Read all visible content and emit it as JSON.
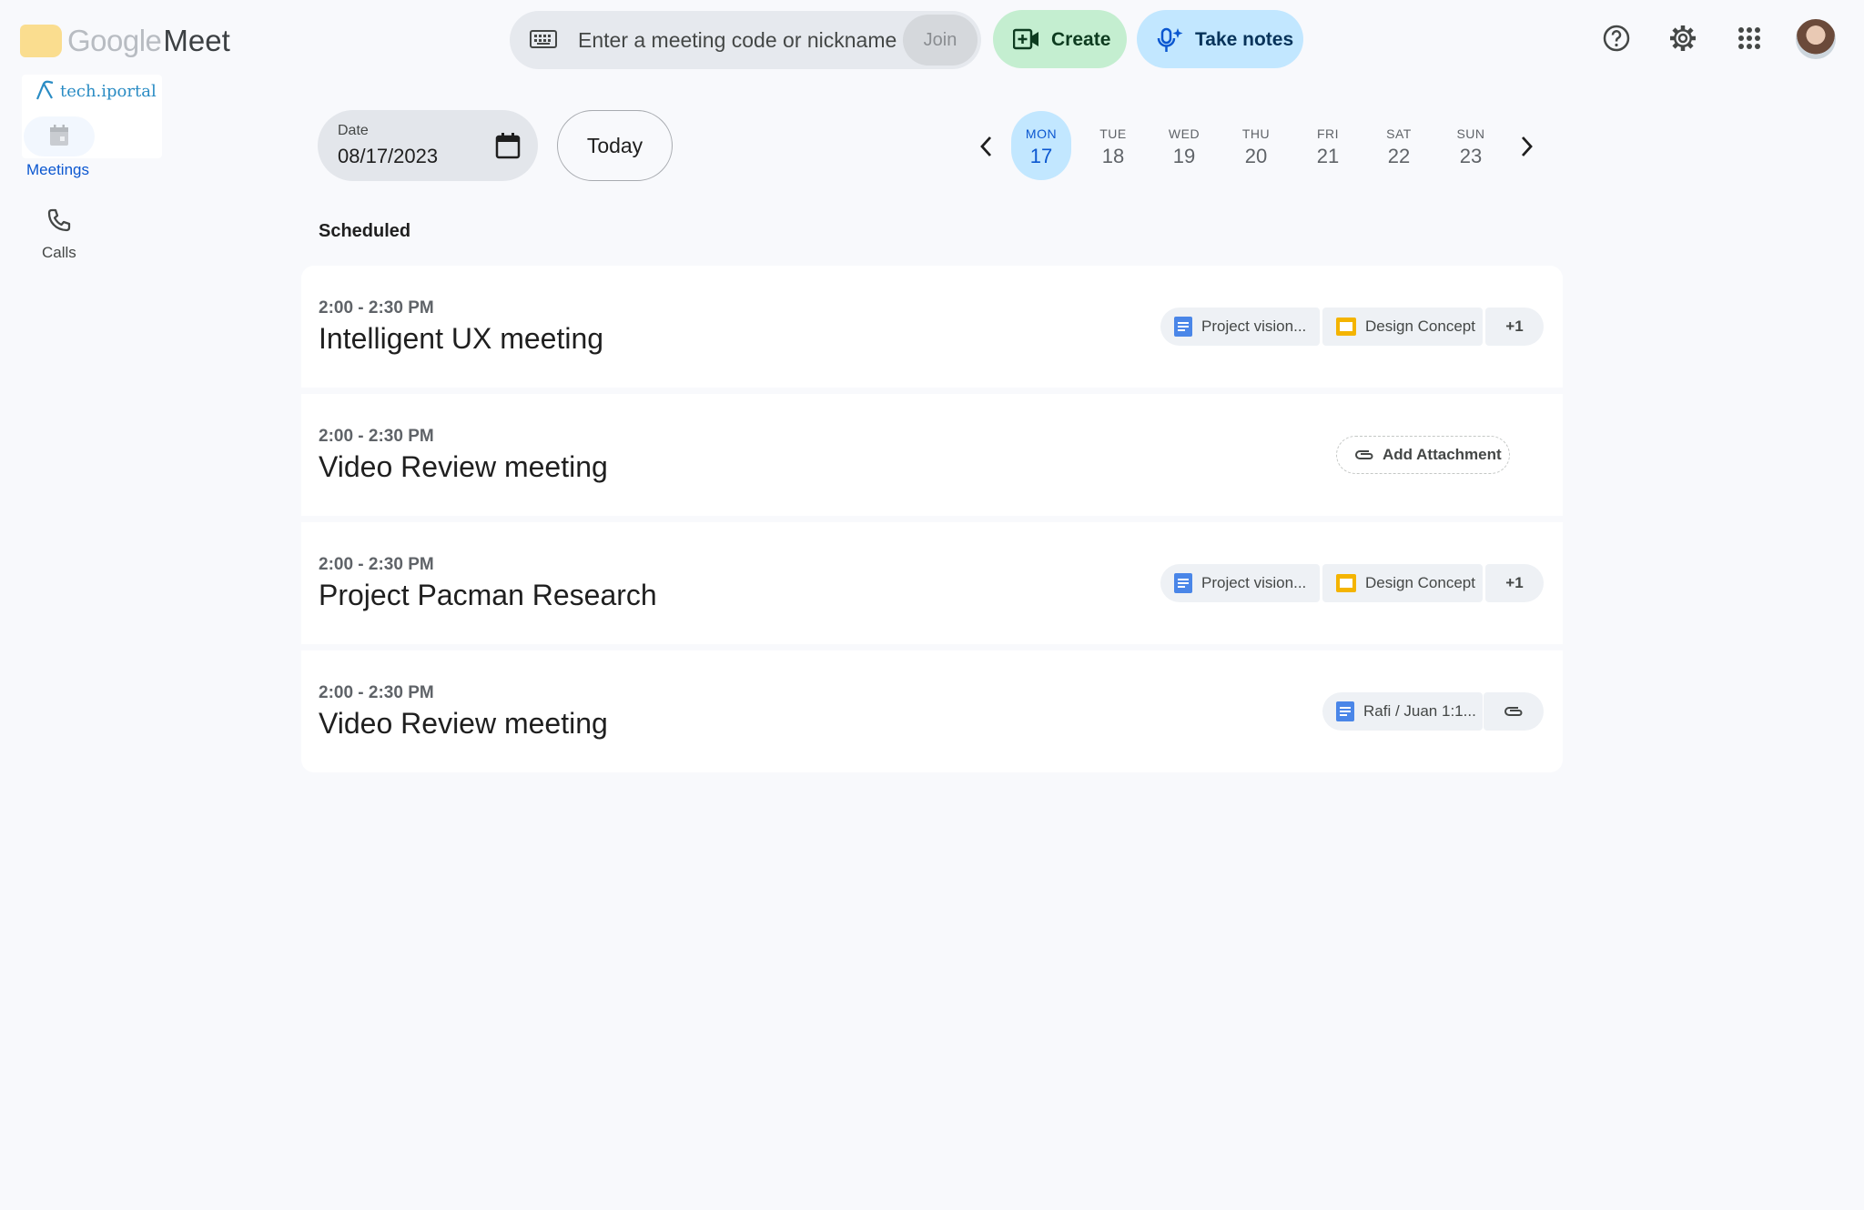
{
  "header": {
    "logo_google": "Google",
    "logo_meet": "Meet",
    "search_placeholder": "Enter a meeting code or nickname",
    "join_label": "Join",
    "create_label": "Create",
    "notes_label": "Take notes"
  },
  "badge": {
    "text": "tech.iportal"
  },
  "sidebar": {
    "items": [
      {
        "label": "Meetings",
        "icon": "calendar-icon",
        "selected": true
      },
      {
        "label": "Calls",
        "icon": "phone-icon",
        "selected": false
      }
    ]
  },
  "date_picker": {
    "label": "Date",
    "value": "08/17/2023",
    "today_label": "Today"
  },
  "week": {
    "days": [
      {
        "name": "MON",
        "num": "17",
        "selected": true
      },
      {
        "name": "TUE",
        "num": "18",
        "selected": false
      },
      {
        "name": "WED",
        "num": "19",
        "selected": false
      },
      {
        "name": "THU",
        "num": "20",
        "selected": false
      },
      {
        "name": "FRI",
        "num": "21",
        "selected": false
      },
      {
        "name": "SAT",
        "num": "22",
        "selected": false
      },
      {
        "name": "SUN",
        "num": "23",
        "selected": false
      }
    ]
  },
  "section_title": "Scheduled",
  "meetings": [
    {
      "time": "2:00 - 2:30 PM",
      "title": "Intelligent UX meeting",
      "attachments": [
        {
          "label": "Project vision...",
          "type": "doc"
        },
        {
          "label": "Design Concept",
          "type": "slides"
        }
      ],
      "more": "+1"
    },
    {
      "time": "2:00 - 2:30 PM",
      "title": "Video Review meeting",
      "add_attachment_label": "Add Attachment"
    },
    {
      "time": "2:00 - 2:30 PM",
      "title": "Project Pacman Research",
      "attachments": [
        {
          "label": "Project vision...",
          "type": "doc"
        },
        {
          "label": "Design Concept",
          "type": "slides"
        }
      ],
      "more": "+1"
    },
    {
      "time": "2:00 - 2:30 PM",
      "title": "Video Review meeting",
      "attachments": [
        {
          "label": "Rafi / Juan 1:1...",
          "type": "doc"
        }
      ]
    }
  ],
  "colors": {
    "background": "#f8f9fc",
    "create_bg": "#c4eed0",
    "notes_bg": "#c2e7ff",
    "selected_day_bg": "#c2e7ff",
    "accent_blue": "#0b57d0",
    "doc_blue": "#4a86e8",
    "slides_yellow": "#f4b400"
  }
}
